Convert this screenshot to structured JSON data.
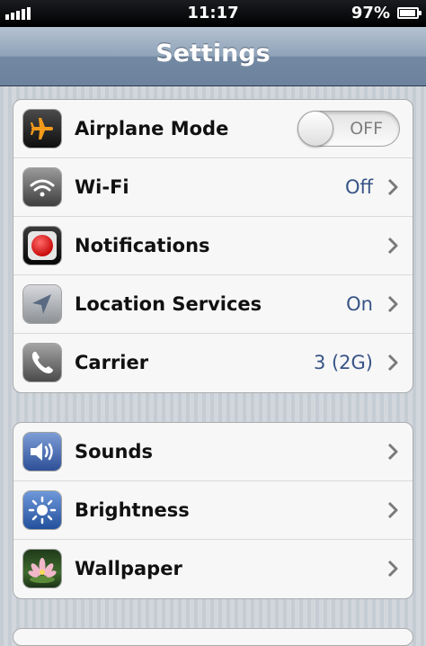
{
  "status_bar": {
    "time": "11:17",
    "battery_percent": "97%",
    "battery_level": 0.97,
    "signal_bars": 5,
    "signal_icon": "signal-bars-icon",
    "battery_icon": "battery-icon"
  },
  "nav_bar": {
    "title": "Settings"
  },
  "groups": [
    {
      "rows": [
        {
          "label": "Airplane Mode",
          "icon": "airplane-icon",
          "control": "toggle",
          "toggle_label": "OFF",
          "toggle_on": false
        },
        {
          "label": "Wi-Fi",
          "icon": "wifi-icon",
          "value": "Off",
          "chevron": true
        },
        {
          "label": "Notifications",
          "icon": "notifications-icon",
          "chevron": true
        },
        {
          "label": "Location Services",
          "icon": "location-arrow-icon",
          "value": "On",
          "chevron": true
        },
        {
          "label": "Carrier",
          "icon": "phone-icon",
          "value": "3 (2G)",
          "chevron": true
        }
      ]
    },
    {
      "rows": [
        {
          "label": "Sounds",
          "icon": "speaker-icon",
          "chevron": true
        },
        {
          "label": "Brightness",
          "icon": "sun-icon",
          "chevron": true
        },
        {
          "label": "Wallpaper",
          "icon": "flower-icon",
          "chevron": true
        }
      ]
    }
  ],
  "colors": {
    "value_text": "#385487",
    "nav_bar_top": "#b6c3d3",
    "nav_bar_bottom": "#6d839d",
    "background": "#cbd2d8"
  }
}
